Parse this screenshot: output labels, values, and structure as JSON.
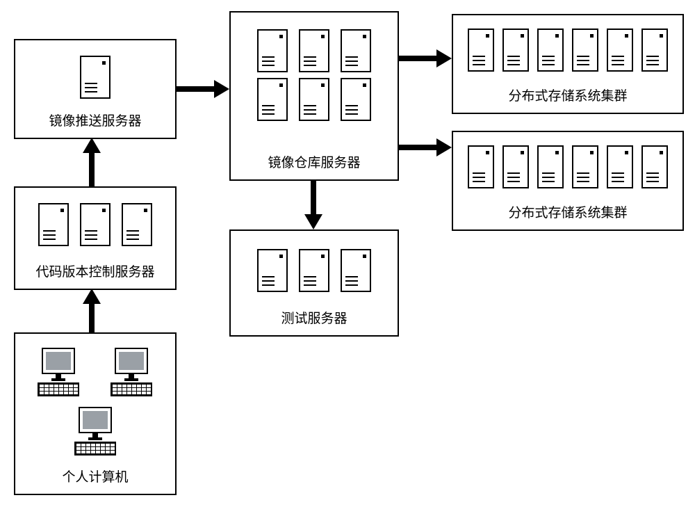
{
  "nodes": {
    "pushServer": {
      "label": "镜像推送服务器"
    },
    "versionCtrl": {
      "label": "代码版本控制服务器"
    },
    "pc": {
      "label": "个人计算机"
    },
    "repoServer": {
      "label": "镜像仓库服务器"
    },
    "testServer": {
      "label": "测试服务器"
    },
    "dssTop": {
      "label": "分布式存储系统集群"
    },
    "dssBottom": {
      "label": "分布式存储系统集群"
    }
  },
  "chart_data": {
    "type": "diagram",
    "nodes": [
      {
        "id": "pc",
        "label": "个人计算机",
        "icons": "pc",
        "count": 3
      },
      {
        "id": "versionCtrl",
        "label": "代码版本控制服务器",
        "icons": "server",
        "count": 3
      },
      {
        "id": "pushServer",
        "label": "镜像推送服务器",
        "icons": "server",
        "count": 1
      },
      {
        "id": "repoServer",
        "label": "镜像仓库服务器",
        "icons": "server",
        "count": 6
      },
      {
        "id": "testServer",
        "label": "测试服务器",
        "icons": "server",
        "count": 3
      },
      {
        "id": "dssTop",
        "label": "分布式存储系统集群",
        "icons": "server",
        "count": 6
      },
      {
        "id": "dssBottom",
        "label": "分布式存储系统集群",
        "icons": "server",
        "count": 6
      }
    ],
    "edges": [
      {
        "from": "pc",
        "to": "versionCtrl"
      },
      {
        "from": "versionCtrl",
        "to": "pushServer"
      },
      {
        "from": "pushServer",
        "to": "repoServer"
      },
      {
        "from": "repoServer",
        "to": "testServer"
      },
      {
        "from": "repoServer",
        "to": "dssTop"
      },
      {
        "from": "repoServer",
        "to": "dssBottom"
      }
    ]
  }
}
